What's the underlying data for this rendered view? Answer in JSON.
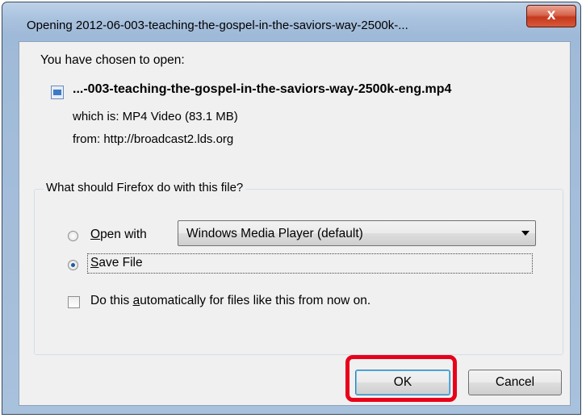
{
  "window": {
    "title": "Opening 2012-06-003-teaching-the-gospel-in-the-saviors-way-2500k-...",
    "close_label": "x"
  },
  "dialog": {
    "chosen_label": "You have chosen to open:",
    "file_icon": "media-file-icon",
    "filename": "...-003-teaching-the-gospel-in-the-saviors-way-2500k-eng.mp4",
    "which_is": "which is:  MP4 Video (83.1 MB)",
    "from": "from:  http://broadcast2.lds.org",
    "group_title": "What should Firefox do with this file?",
    "open_with": {
      "before": "",
      "accel": "O",
      "after": "pen with",
      "selected": false
    },
    "app_dropdown": {
      "value": "Windows Media Player (default)"
    },
    "save_file": {
      "before": "",
      "accel": "S",
      "after": "ave File",
      "selected": true
    },
    "auto_checkbox": {
      "before": "Do this ",
      "accel": "a",
      "after": "utomatically for files like this from now on.",
      "checked": false
    },
    "ok_label": "OK",
    "cancel_label": "Cancel"
  },
  "colors": {
    "highlight": "#e8001a",
    "titlebar": "#a9c2de",
    "close_button": "#c4391f"
  }
}
